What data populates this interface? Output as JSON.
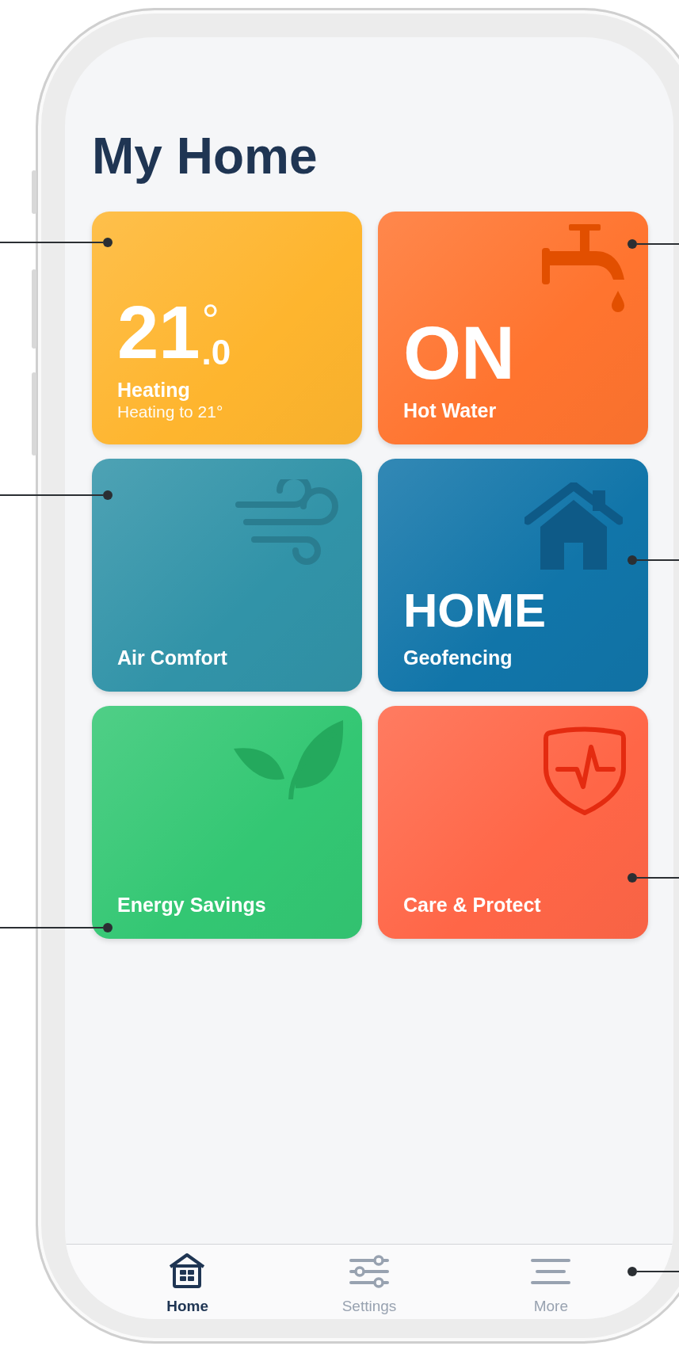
{
  "title": "My Home",
  "tile_rows": [
    {
      "tiles": [
        {
          "kind": "heating",
          "color": "#feb52e",
          "reading": "21",
          "degree": "°",
          "decimal": ".0",
          "label": "Heating",
          "sublabel": "Heating to 21°"
        },
        {
          "kind": "hot_water",
          "color": "#ff742f",
          "reading": "ON",
          "label": "Hot Water"
        }
      ]
    },
    {
      "tiles": [
        {
          "kind": "air",
          "color": "#3193a8",
          "label": "Air Comfort"
        },
        {
          "kind": "geofence",
          "color": "#1175a9",
          "reading": "HOME",
          "label": "Geofencing"
        }
      ]
    },
    {
      "tiles": [
        {
          "kind": "energy",
          "color": "#33c773",
          "label": "Energy Savings"
        },
        {
          "kind": "care",
          "color": "#ff6647",
          "label": "Care & Protect"
        }
      ]
    }
  ],
  "nav": [
    {
      "kind": "home",
      "label": "Home",
      "selected": true
    },
    {
      "kind": "settings",
      "label": "Settings",
      "selected": false
    },
    {
      "kind": "more",
      "label": "More",
      "selected": false
    }
  ]
}
